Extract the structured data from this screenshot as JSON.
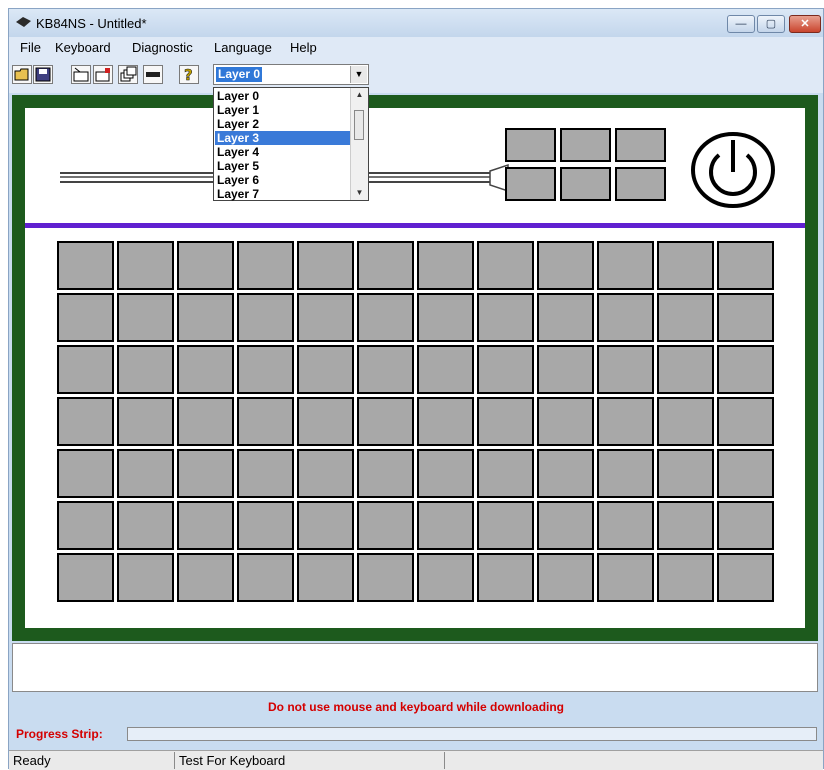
{
  "window": {
    "title": "KB84NS - Untitled*"
  },
  "window_controls": {
    "minimize": "—",
    "maximize": "▢",
    "close": "✕"
  },
  "menu": {
    "items": [
      "File",
      "Keyboard",
      "Diagnostic",
      "Language",
      "Help"
    ]
  },
  "toolbar": {
    "icons": [
      "open-folder-icon",
      "save-icon",
      "keyboard-icon",
      "download-icon",
      "layers-icon",
      "bar-icon",
      "help-icon"
    ],
    "layer_select": {
      "value": "Layer 0",
      "options": [
        "Layer 0",
        "Layer 1",
        "Layer 2",
        "Layer 3",
        "Layer 4",
        "Layer 5",
        "Layer 6",
        "Layer 7"
      ],
      "highlighted": "Layer 3",
      "open": true
    }
  },
  "colors": {
    "frame": "#1d5a1d",
    "divider": "#6020d0",
    "key": "#a8a8a8",
    "warning": "#d40000",
    "highlight": "#3a7ad8"
  },
  "keyboard": {
    "top_keys": {
      "rows": 2,
      "cols": 3
    },
    "grid": {
      "rows": 7,
      "cols": 12
    }
  },
  "message": {
    "warning": "Do not use mouse and keyboard while downloading",
    "progress_label": "Progress Strip:"
  },
  "progress": {
    "value": 0
  },
  "status": {
    "pane1": "Ready",
    "pane2": "Test For Keyboard",
    "pane3": ""
  }
}
